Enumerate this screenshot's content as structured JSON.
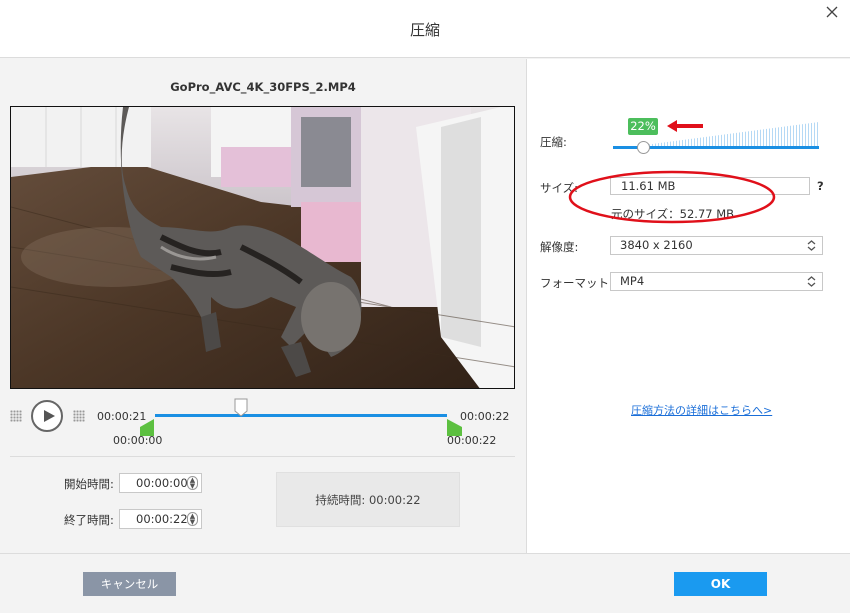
{
  "dialog": {
    "title": "圧縮"
  },
  "player": {
    "filename": "GoPro_AVC_4K_30FPS_2.MP4",
    "time_left_top": "00:00:21",
    "time_left_bottom": "00:00:00",
    "time_right_top": "00:00:22",
    "time_right_bottom": "00:00:22"
  },
  "trim": {
    "start_label": "開始時間:",
    "start_value": "00:00:00",
    "end_label": "終了時間:",
    "end_value": "00:00:22",
    "duration_label": "持続時間:",
    "duration_value": "00:00:22"
  },
  "compress": {
    "label": "圧縮:",
    "percent": "22%",
    "slider_value": 22,
    "size_label": "サイズ:",
    "size_value": "11.61  MB",
    "help": "?",
    "original_size": "元のサイズ：52.77 MB",
    "resolution_label": "解像度:",
    "resolution_value": "3840 x 2160",
    "format_label": "フォーマット:",
    "format_value": "MP4",
    "details_link": "圧縮方法の詳細はこちらへ>"
  },
  "footer": {
    "cancel_label": "キャンセル",
    "ok_label": "OK"
  },
  "colors": {
    "accent": "#1a8fe3",
    "flag_green": "#5cc040",
    "badge_green": "#4cbe5c",
    "annotation_red": "#e0101a",
    "ok_button": "#1a9af0",
    "cancel_button": "#8a95a6"
  }
}
